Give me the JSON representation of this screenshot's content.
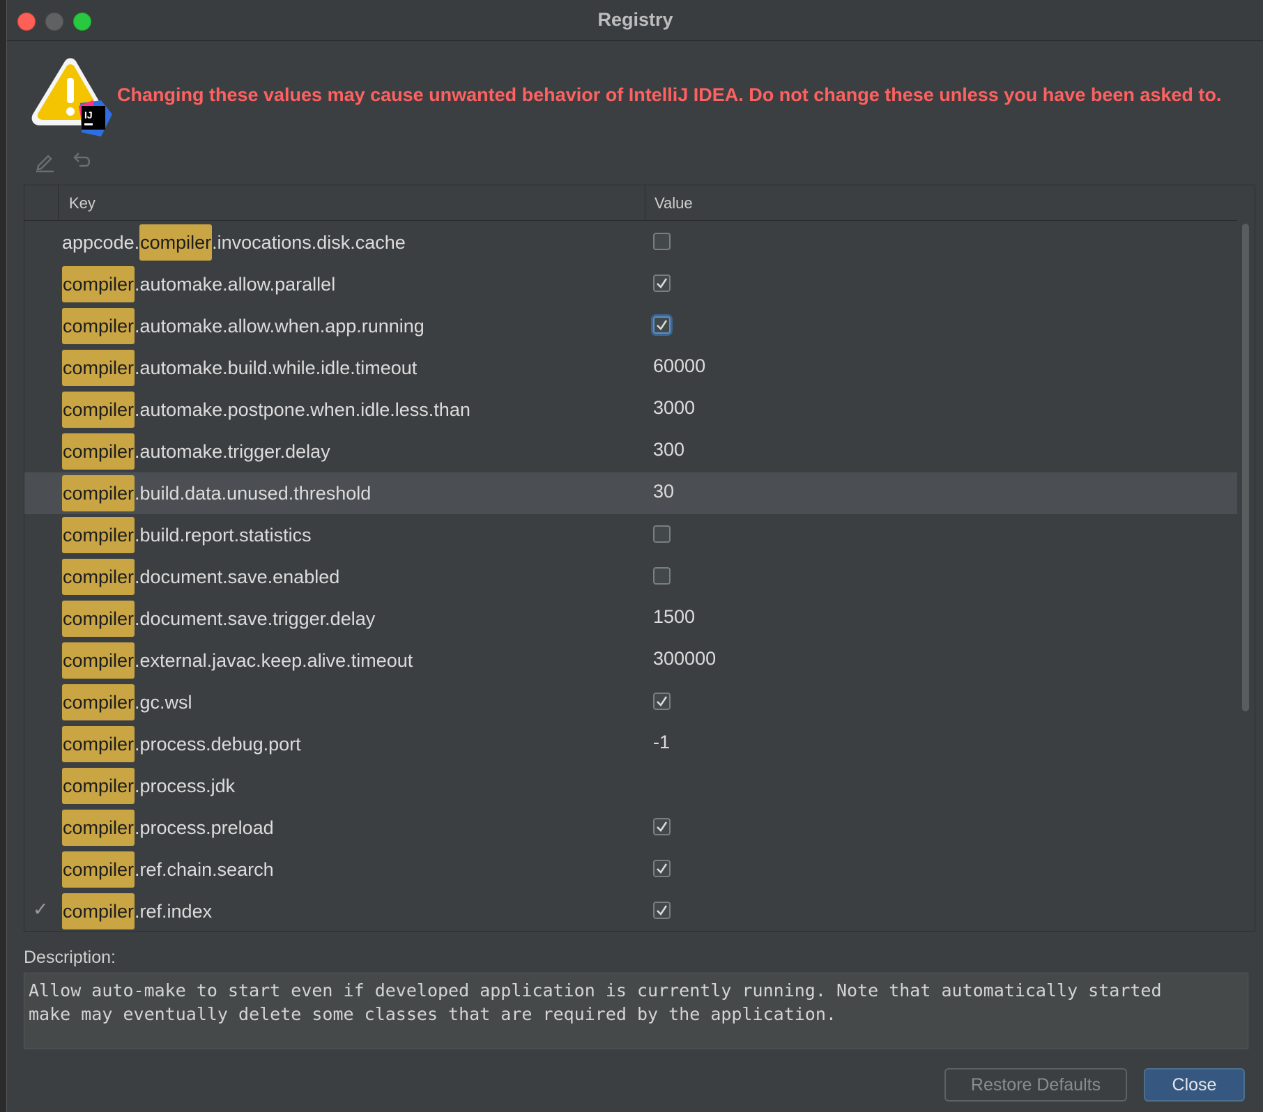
{
  "window": {
    "title": "Registry"
  },
  "warning": {
    "text": "Changing these values may cause unwanted behavior of IntelliJ IDEA. Do not change these unless you have been asked to.",
    "icon": "warning-intellij-icon"
  },
  "toolbar": {
    "edit_icon": "pencil-icon",
    "revert_icon": "undo-icon"
  },
  "table": {
    "columns": {
      "key": "Key",
      "value": "Value"
    },
    "highlight_term": "compiler",
    "rows": [
      {
        "prefix": "appcode.",
        "match": "compiler",
        "suffix": ".invocations.disk.cache",
        "type": "bool",
        "checked": false,
        "modified": ""
      },
      {
        "prefix": "",
        "match": "compiler",
        "suffix": ".automake.allow.parallel",
        "type": "bool",
        "checked": true,
        "modified": ""
      },
      {
        "prefix": "",
        "match": "compiler",
        "suffix": ".automake.allow.when.app.running",
        "type": "bool",
        "checked": true,
        "focused": true,
        "modified": ""
      },
      {
        "prefix": "",
        "match": "compiler",
        "suffix": ".automake.build.while.idle.timeout",
        "type": "text",
        "value": "60000",
        "modified": ""
      },
      {
        "prefix": "",
        "match": "compiler",
        "suffix": ".automake.postpone.when.idle.less.than",
        "type": "text",
        "value": "3000",
        "modified": ""
      },
      {
        "prefix": "",
        "match": "compiler",
        "suffix": ".automake.trigger.delay",
        "type": "text",
        "value": "300",
        "modified": ""
      },
      {
        "prefix": "",
        "match": "compiler",
        "suffix": ".build.data.unused.threshold",
        "type": "text",
        "value": "30",
        "selected": true,
        "modified": ""
      },
      {
        "prefix": "",
        "match": "compiler",
        "suffix": ".build.report.statistics",
        "type": "bool",
        "checked": false,
        "modified": ""
      },
      {
        "prefix": "",
        "match": "compiler",
        "suffix": ".document.save.enabled",
        "type": "bool",
        "checked": false,
        "modified": ""
      },
      {
        "prefix": "",
        "match": "compiler",
        "suffix": ".document.save.trigger.delay",
        "type": "text",
        "value": "1500",
        "modified": ""
      },
      {
        "prefix": "",
        "match": "compiler",
        "suffix": ".external.javac.keep.alive.timeout",
        "type": "text",
        "value": "300000",
        "modified": ""
      },
      {
        "prefix": "",
        "match": "compiler",
        "suffix": ".gc.wsl",
        "type": "bool",
        "checked": true,
        "modified": ""
      },
      {
        "prefix": "",
        "match": "compiler",
        "suffix": ".process.debug.port",
        "type": "text",
        "value": "-1",
        "modified": ""
      },
      {
        "prefix": "",
        "match": "compiler",
        "suffix": ".process.jdk",
        "type": "text",
        "value": "",
        "modified": ""
      },
      {
        "prefix": "",
        "match": "compiler",
        "suffix": ".process.preload",
        "type": "bool",
        "checked": true,
        "modified": ""
      },
      {
        "prefix": "",
        "match": "compiler",
        "suffix": ".ref.chain.search",
        "type": "bool",
        "checked": true,
        "modified": ""
      },
      {
        "prefix": "",
        "match": "compiler",
        "suffix": ".ref.index",
        "type": "bool",
        "checked": true,
        "modified": "✓"
      }
    ]
  },
  "description": {
    "label": "Description:",
    "text": "Allow auto-make to start even if developed application is currently running. Note that automatically started\nmake may eventually delete some classes that are required by the application."
  },
  "buttons": {
    "restore": "Restore Defaults",
    "close": "Close"
  },
  "colors": {
    "highlight": "#c9a544",
    "warning": "#ff6161",
    "primary_button": "#365880"
  }
}
